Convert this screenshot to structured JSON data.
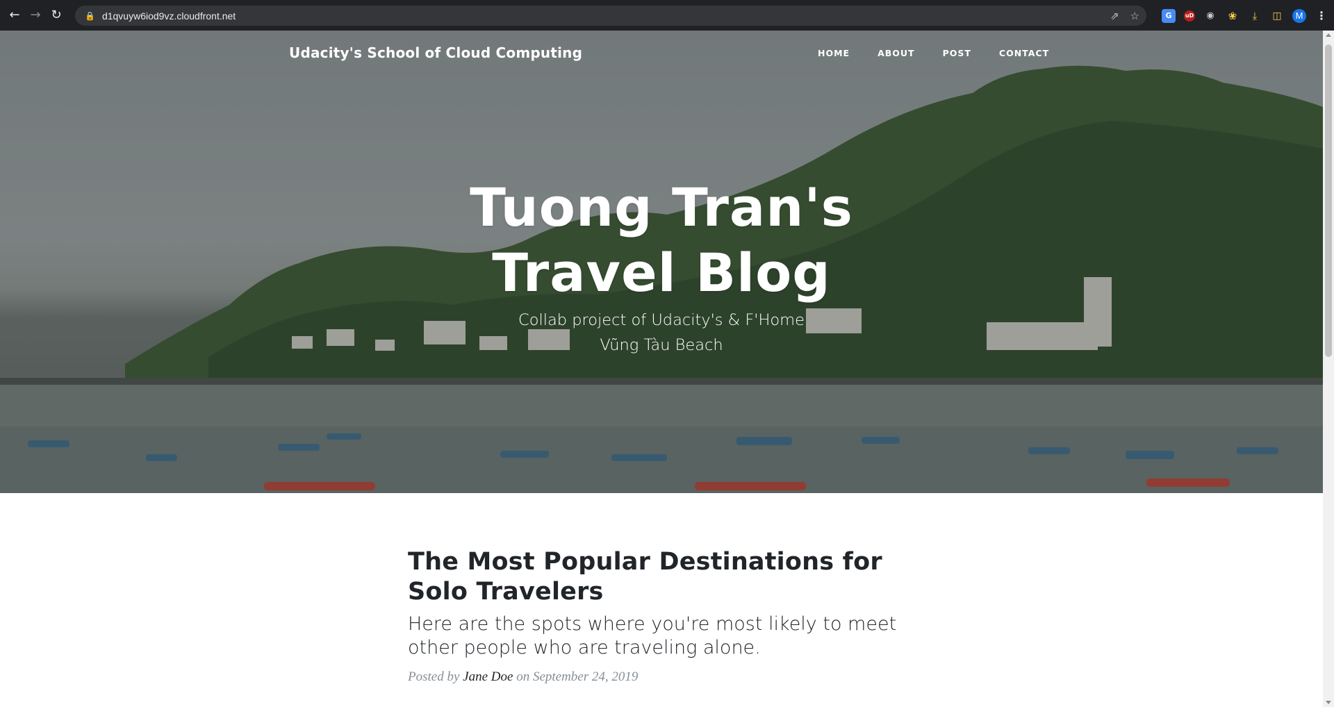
{
  "browser": {
    "url": "d1qvuyw6iod9vz.cloudfront.net",
    "profile_initial": "M",
    "icons": [
      "back-icon",
      "forward-icon",
      "reload-icon",
      "lock-icon",
      "share-icon",
      "star-icon",
      "translate-icon",
      "ublock-icon",
      "lens-icon",
      "puzzle-icon",
      "download-icon",
      "side-panel-icon",
      "kebab-menu-icon"
    ],
    "extension_labels": {
      "translate": "G",
      "ublock": "uD"
    }
  },
  "site": {
    "brand": "Udacity's School of Cloud Computing",
    "nav": [
      {
        "label": "HOME"
      },
      {
        "label": "ABOUT"
      },
      {
        "label": "POST"
      },
      {
        "label": "CONTACT"
      }
    ]
  },
  "hero": {
    "title": "Tuong Tran's Travel Blog",
    "subtitle_line1": "Collab project of Udacity's & F'Home",
    "subtitle_line2": "Vũng Tàu Beach"
  },
  "post": {
    "title": "The Most Popular Destinations for Solo Travelers",
    "subtitle": "Here are the spots where you're most likely to meet other people who are traveling alone.",
    "meta_prefix": "Posted by",
    "author": "Jane Doe",
    "meta_on": "on",
    "date": "September 24, 2019"
  },
  "colors": {
    "chrome_bg": "#202124",
    "omnibox_bg": "#35363a",
    "text_dark": "#212529",
    "meta_gray": "#868e96",
    "hero_overlay": "#1e2328"
  }
}
